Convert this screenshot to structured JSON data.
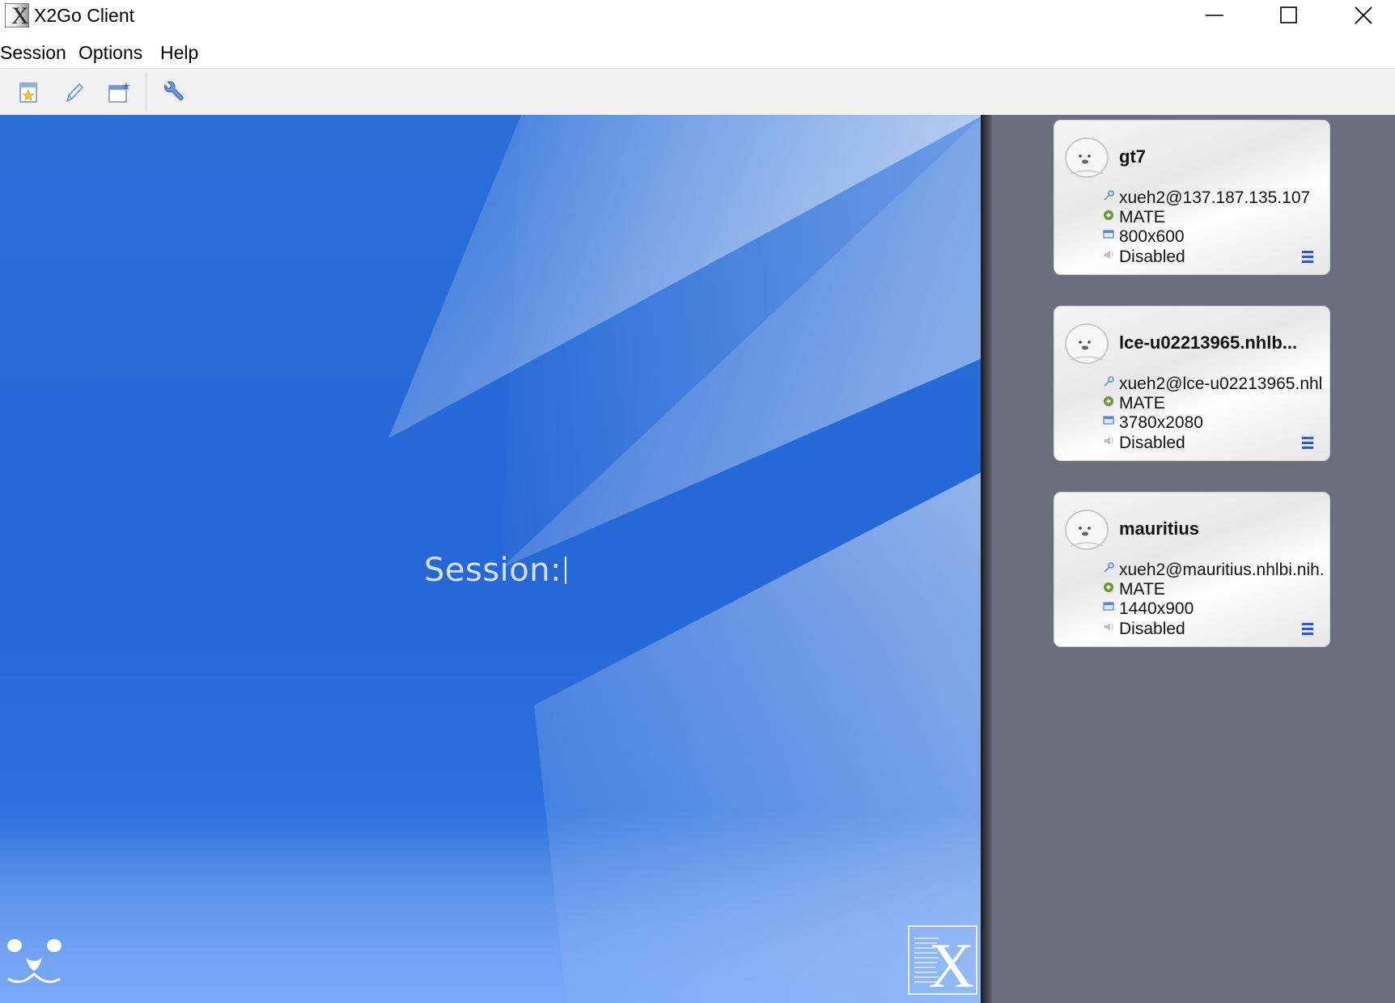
{
  "window": {
    "title": "X2Go Client",
    "icon": "x2go-app-icon"
  },
  "menu": {
    "items": [
      "Session",
      "Options",
      "Help"
    ]
  },
  "toolbar": {
    "buttons": [
      {
        "name": "new-session",
        "icon": "new-session-icon"
      },
      {
        "name": "edit-session",
        "icon": "pencil-icon"
      },
      {
        "name": "new-window",
        "icon": "new-window-icon"
      },
      {
        "name": "settings",
        "icon": "wrench-icon"
      }
    ]
  },
  "stage": {
    "session_label": "Session:",
    "logo": "X"
  },
  "sessions": [
    {
      "name": "gt7",
      "login": "xueh2@137.187.135.107",
      "desktop": "MATE",
      "resolution": "800x600",
      "sound": "Disabled"
    },
    {
      "name": "lce-u02213965.nhlb...",
      "login": "xueh2@lce-u02213965.nhl",
      "desktop": "MATE",
      "resolution": "3780x2080",
      "sound": "Disabled"
    },
    {
      "name": "mauritius",
      "login": "xueh2@mauritius.nhlbi.nih.",
      "desktop": "MATE",
      "resolution": "1440x900",
      "sound": "Disabled"
    }
  ],
  "colors": {
    "stage_blue": "#2567d6",
    "panel_gray": "#6c6e7d",
    "menu_icon_blue": "#2a5bd7"
  }
}
